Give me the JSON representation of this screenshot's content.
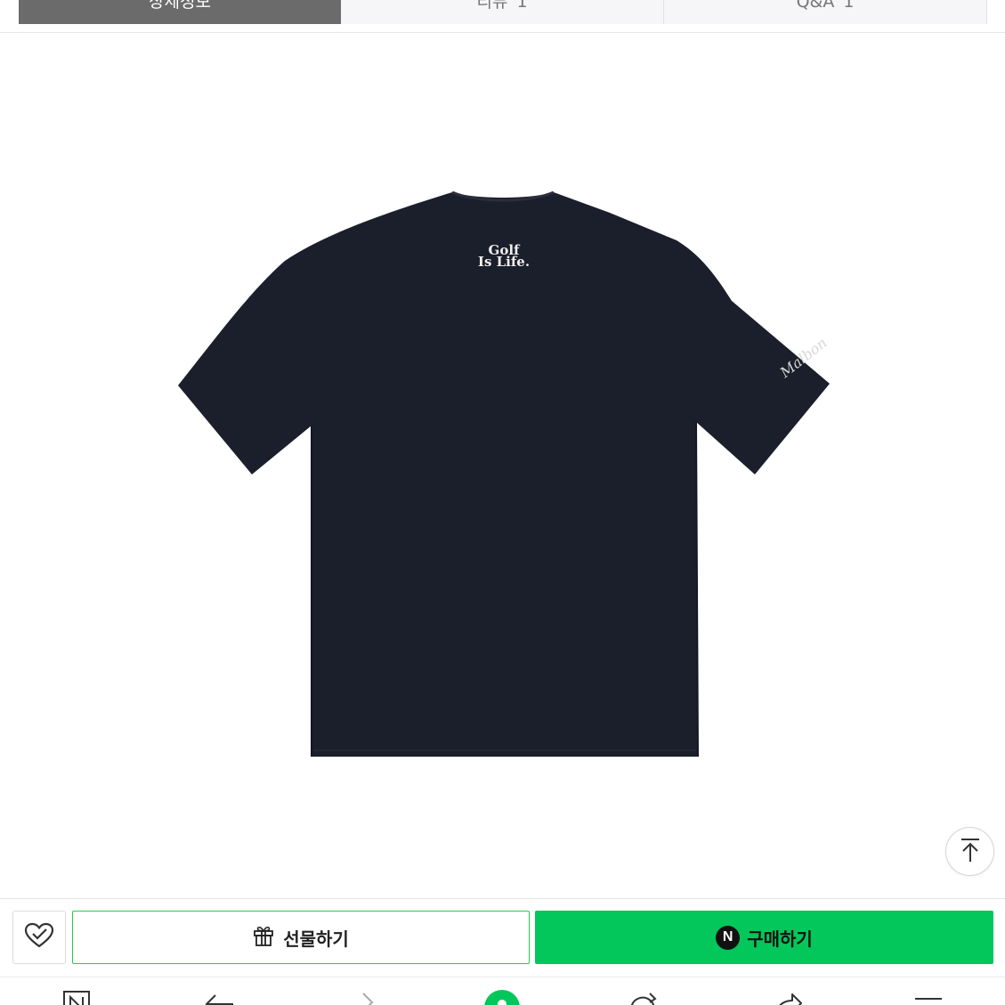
{
  "tabs": [
    {
      "label": "상세정보",
      "count": "",
      "active": true
    },
    {
      "label": "리뷰",
      "count": "1",
      "active": false
    },
    {
      "label": "Q&A",
      "count": "1",
      "active": false
    }
  ],
  "product_image": {
    "print_line1": "Golf",
    "print_line2": "Is Life.",
    "sleeve_script": "Malbon",
    "shirt_color": "#1b1e2b"
  },
  "scroll_top": {
    "icon": "arrow-up-to-top-icon"
  },
  "purchase_bar": {
    "wish_icon": "heart-check-icon",
    "gift_icon": "gift-icon",
    "gift_label": "선물하기",
    "buy_badge": "N",
    "buy_label": "구매하기",
    "buy_color": "#03c75a"
  },
  "browser_nav": {
    "icons": [
      "naver-n-icon",
      "back-icon",
      "forward-icon",
      "green-home-icon",
      "refresh-icon",
      "share-icon",
      "menu-icon"
    ]
  }
}
